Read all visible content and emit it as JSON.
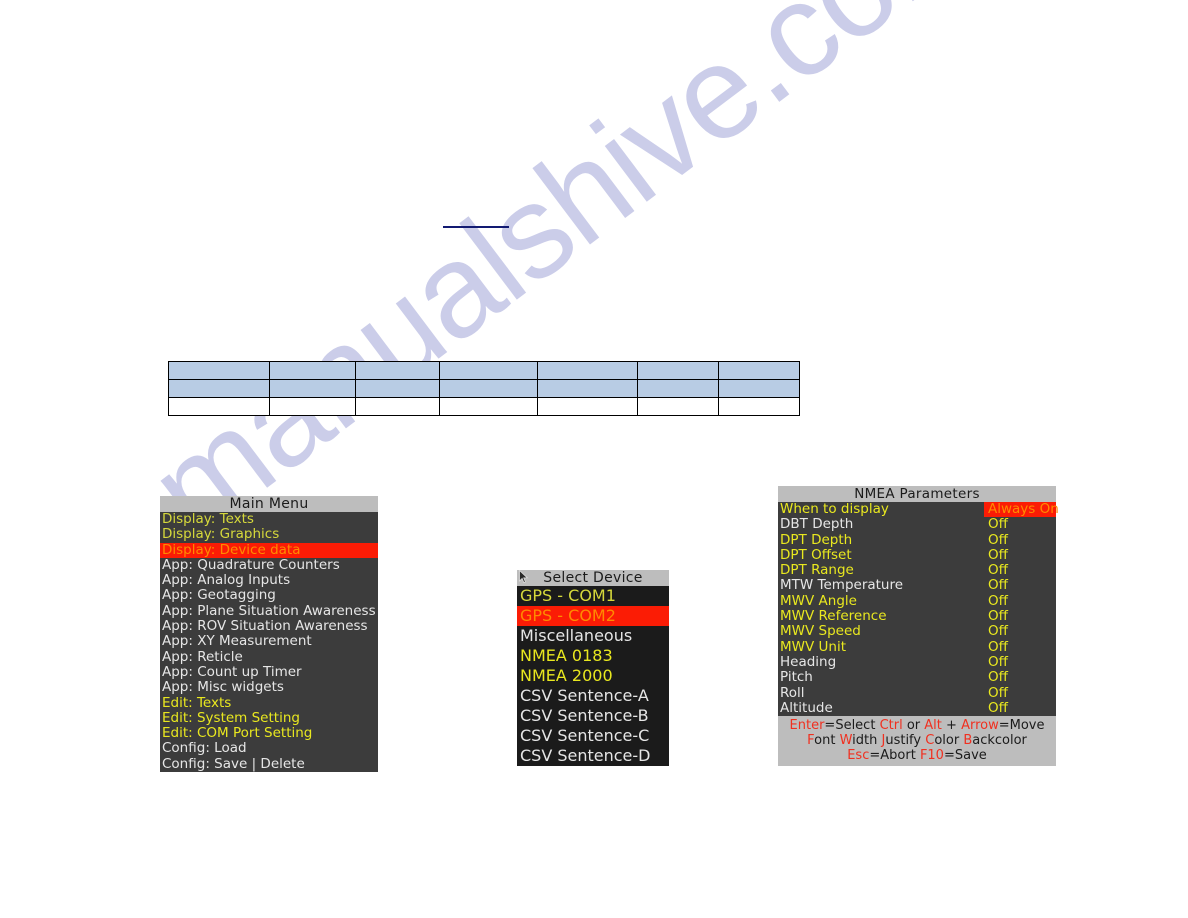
{
  "page": {
    "watermark": "manualshive.com",
    "background": "#ffffff"
  },
  "rule": {
    "name": "blue-underline",
    "color": "#121a72"
  },
  "table": {
    "columns": 7,
    "header_rows": 2,
    "body_rows": 1,
    "header_fill": "#b8cce4",
    "body_fill": "#ffffff",
    "border": "#000000",
    "rows": [
      [
        "",
        "",
        "",
        "",
        "",
        "",
        ""
      ],
      [
        "",
        "",
        "",
        "",
        "",
        "",
        ""
      ],
      [
        "",
        "",
        "",
        "",
        "",
        "",
        ""
      ]
    ]
  },
  "main_menu": {
    "title": "Main Menu",
    "items": [
      {
        "label": "Display: Texts",
        "color": "#d6d93b",
        "selected": false
      },
      {
        "label": "Display: Graphics",
        "color": "#d6d93b",
        "selected": false
      },
      {
        "label": "Display: Device data",
        "color": "#ff8a00",
        "selected": true
      },
      {
        "label": "App: Quadrature Counters",
        "color": "#e6e6e6",
        "selected": false
      },
      {
        "label": "App: Analog Inputs",
        "color": "#e6e6e6",
        "selected": false
      },
      {
        "label": "App: Geotagging",
        "color": "#e6e6e6",
        "selected": false
      },
      {
        "label": "App: Plane Situation Awareness",
        "color": "#e6e6e6",
        "selected": false
      },
      {
        "label": "App: ROV Situation Awareness",
        "color": "#e6e6e6",
        "selected": false
      },
      {
        "label": "App: XY Measurement",
        "color": "#e6e6e6",
        "selected": false
      },
      {
        "label": "App: Reticle",
        "color": "#e6e6e6",
        "selected": false
      },
      {
        "label": "App: Count up Timer",
        "color": "#e6e6e6",
        "selected": false
      },
      {
        "label": "App: Misc widgets",
        "color": "#e6e6e6",
        "selected": false
      },
      {
        "label": "Edit: Texts",
        "color": "#e9e81f",
        "selected": false
      },
      {
        "label": "Edit: System Setting",
        "color": "#e9e81f",
        "selected": false
      },
      {
        "label": "Edit: COM Port Setting",
        "color": "#e9e81f",
        "selected": false
      },
      {
        "label": "Config: Load",
        "color": "#e6e6e6",
        "selected": false
      },
      {
        "label": "Config: Save | Delete",
        "color": "#e6e6e6",
        "selected": false
      }
    ]
  },
  "select_device": {
    "title": "Select Device",
    "cursor_icon": "mouse-pointer-icon",
    "items": [
      {
        "label": "GPS - COM1",
        "color": "#d6d93b",
        "selected": false
      },
      {
        "label": "GPS - COM2",
        "color": "#ff8a00",
        "selected": true
      },
      {
        "label": "Miscellaneous",
        "color": "#e6e6e6",
        "selected": false
      },
      {
        "label": "NMEA 0183",
        "color": "#e9e81f",
        "selected": false
      },
      {
        "label": "NMEA 2000",
        "color": "#e9e81f",
        "selected": false
      },
      {
        "label": "CSV Sentence-A",
        "color": "#e6e6e6",
        "selected": false
      },
      {
        "label": "CSV Sentence-B",
        "color": "#e6e6e6",
        "selected": false
      },
      {
        "label": "CSV Sentence-C",
        "color": "#e6e6e6",
        "selected": false
      },
      {
        "label": "CSV Sentence-D",
        "color": "#e6e6e6",
        "selected": false
      }
    ]
  },
  "nmea_params": {
    "title": "NMEA Parameters",
    "rows": [
      {
        "label": "When to display",
        "label_color": "#e9e81f",
        "value": "Always On",
        "value_color": "#ff8a00",
        "highlighted": true
      },
      {
        "label": "DBT Depth",
        "label_color": "#e6e6e6",
        "value": "Off",
        "value_color": "#e9e81f",
        "highlighted": false
      },
      {
        "label": "DPT Depth",
        "label_color": "#e9e81f",
        "value": "Off",
        "value_color": "#e9e81f",
        "highlighted": false
      },
      {
        "label": "DPT Offset",
        "label_color": "#e9e81f",
        "value": "Off",
        "value_color": "#e9e81f",
        "highlighted": false
      },
      {
        "label": "DPT Range",
        "label_color": "#e9e81f",
        "value": "Off",
        "value_color": "#e9e81f",
        "highlighted": false
      },
      {
        "label": "MTW Temperature",
        "label_color": "#e6e6e6",
        "value": "Off",
        "value_color": "#e9e81f",
        "highlighted": false
      },
      {
        "label": "MWV Angle",
        "label_color": "#e9e81f",
        "value": "Off",
        "value_color": "#e9e81f",
        "highlighted": false
      },
      {
        "label": "MWV Reference",
        "label_color": "#e9e81f",
        "value": "Off",
        "value_color": "#e9e81f",
        "highlighted": false
      },
      {
        "label": "MWV Speed",
        "label_color": "#e9e81f",
        "value": "Off",
        "value_color": "#e9e81f",
        "highlighted": false
      },
      {
        "label": "MWV Unit",
        "label_color": "#e9e81f",
        "value": "Off",
        "value_color": "#e9e81f",
        "highlighted": false
      },
      {
        "label": "Heading",
        "label_color": "#e6e6e6",
        "value": "Off",
        "value_color": "#e9e81f",
        "highlighted": false
      },
      {
        "label": "Pitch",
        "label_color": "#e6e6e6",
        "value": "Off",
        "value_color": "#e9e81f",
        "highlighted": false
      },
      {
        "label": "Roll",
        "label_color": "#e6e6e6",
        "value": "Off",
        "value_color": "#e9e81f",
        "highlighted": false
      },
      {
        "label": "Altitude",
        "label_color": "#e6e6e6",
        "value": "Off",
        "value_color": "#e9e81f",
        "highlighted": false
      }
    ],
    "key_help": [
      [
        {
          "t": "Enter",
          "k": true
        },
        {
          "t": "=Select ",
          "k": false
        },
        {
          "t": "Ctrl",
          "k": true
        },
        {
          "t": " or ",
          "k": false
        },
        {
          "t": "Alt",
          "k": true
        },
        {
          "t": " + ",
          "k": false
        },
        {
          "t": "Arrow",
          "k": true
        },
        {
          "t": "=Move",
          "k": false
        }
      ],
      [
        {
          "t": "F",
          "k": true
        },
        {
          "t": "ont ",
          "k": false
        },
        {
          "t": "W",
          "k": true
        },
        {
          "t": "idth ",
          "k": false
        },
        {
          "t": "J",
          "k": true
        },
        {
          "t": "ustify ",
          "k": false
        },
        {
          "t": "C",
          "k": true
        },
        {
          "t": "olor ",
          "k": false
        },
        {
          "t": "B",
          "k": true
        },
        {
          "t": "ackcolor",
          "k": false
        }
      ],
      [
        {
          "t": "Esc",
          "k": true
        },
        {
          "t": "=Abort ",
          "k": false
        },
        {
          "t": "F10",
          "k": true
        },
        {
          "t": "=Save",
          "k": false
        }
      ]
    ]
  }
}
